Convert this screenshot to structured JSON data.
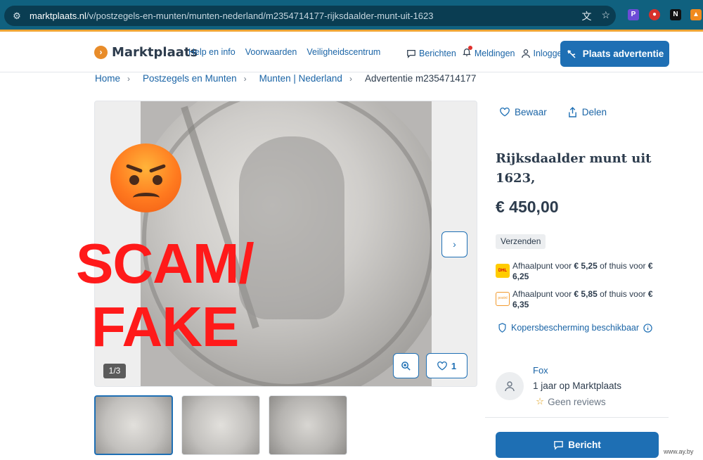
{
  "browser": {
    "url_host": "marktplaats.nl",
    "url_path": "/v/postzegels-en-munten/munten-nederland/m2354714177-rijksdaalder-munt-uit-1623",
    "icons": [
      "tune-icon",
      "translate-icon",
      "star-icon"
    ],
    "extensions": [
      "pdf-extension-icon",
      "tomato-extension-icon",
      "notion-extension-icon",
      "avast-extension-icon"
    ],
    "accent_color": "#eea536",
    "bar_color": "#10617f"
  },
  "header": {
    "logo_text": "Marktplaats",
    "nav": [
      "Help en info",
      "Voorwaarden",
      "Veiligheidscentrum"
    ],
    "messages_label": "Berichten",
    "notifications_label": "Meldingen",
    "login_label": "Inloggen",
    "place_ad_label": "Plaats advertentie",
    "brand_color": "#1e6fb4"
  },
  "breadcrumb": {
    "home": "Home",
    "category": "Postzegels en Munten",
    "subcategory": "Munten | Nederland",
    "current": "Advertentie m2354714177"
  },
  "gallery": {
    "counter": "1/3",
    "likes": "1",
    "overlay_line1": "SCAM/",
    "overlay_line2": "FAKE",
    "overlay_color": "#ff1a1a"
  },
  "listing": {
    "save_label": "Bewaar",
    "share_label": "Delen",
    "title": "Rijksdaalder munt uit 1623,",
    "price": "€ 450,00",
    "shipping_badge": "Verzenden",
    "dhl_text_a": "Afhaalpunt voor ",
    "dhl_price_a": "€ 5,25",
    "dhl_text_b": " of thuis voor ",
    "dhl_price_b": "€ 6,25",
    "postnl_text_a": "Afhaalpunt voor ",
    "postnl_price_a": "€ 5,85",
    "postnl_text_b": " of thuis voor ",
    "postnl_price_b": "€ 6,35",
    "dhl_logo": "DHL",
    "postnl_logo": "postnl",
    "protection_label": "Kopersbescherming beschikbaar"
  },
  "seller": {
    "name": "Fox",
    "since": "1 jaar op Marktplaats",
    "reviews": "Geen reviews",
    "message_button": "Bericht"
  },
  "watermark": "www.ay.by"
}
